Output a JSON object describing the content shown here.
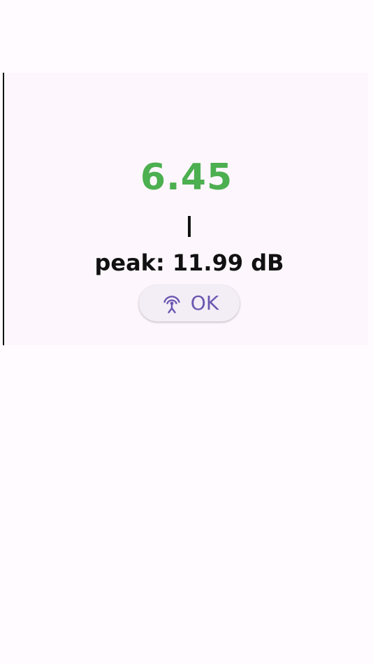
{
  "meter": {
    "level_value": "6.45",
    "level_color": "#4caf50",
    "peak_label": "peak:",
    "peak_value": "11.99",
    "peak_unit": "dB"
  },
  "status_button": {
    "icon": "antenna-icon",
    "label": "OK",
    "accent_color": "#6a57b0"
  }
}
